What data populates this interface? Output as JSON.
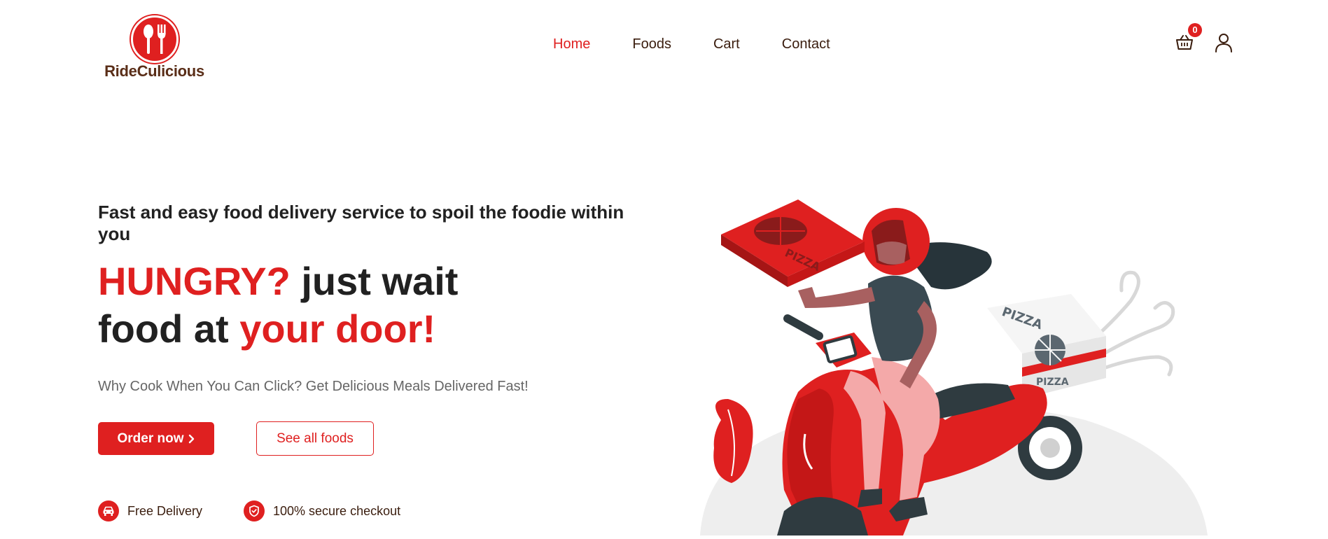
{
  "brand": {
    "name": "RideCulicious"
  },
  "nav": {
    "items": [
      {
        "label": "Home",
        "active": true
      },
      {
        "label": "Foods",
        "active": false
      },
      {
        "label": "Cart",
        "active": false
      },
      {
        "label": "Contact",
        "active": false
      }
    ]
  },
  "header": {
    "cart_count": "0",
    "cart_icon": "basket-icon",
    "user_icon": "user-icon"
  },
  "hero": {
    "subtitle": "Fast and easy food delivery service to spoil the foodie within you",
    "title_line1_red": "HUNGRY?",
    "title_line1_dark": " just wait",
    "title_line2_dark": "food at ",
    "title_line2_red": "your door!",
    "tagline": "Why Cook When You Can Click? Get Delicious Meals Delivered Fast!",
    "order_button": "Order now",
    "all_foods_button": "See all foods"
  },
  "features": [
    {
      "label": "Free Delivery",
      "icon": "car-icon"
    },
    {
      "label": "100% secure checkout",
      "icon": "shield-check-icon"
    }
  ],
  "colors": {
    "accent": "#df2020",
    "dark_text": "#212121",
    "brown_text": "#3a1d0e",
    "muted_text": "#666666"
  }
}
